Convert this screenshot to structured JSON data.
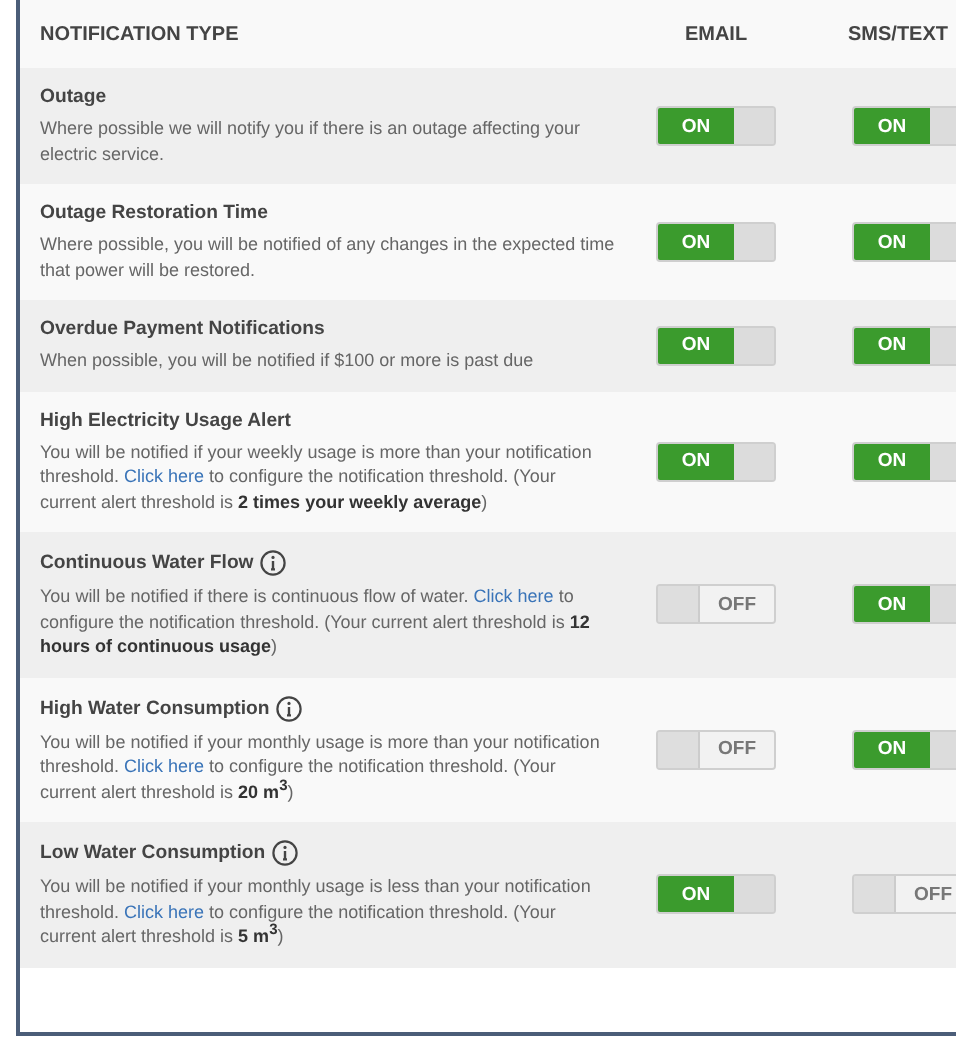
{
  "header": {
    "type": "NOTIFICATION TYPE",
    "email": "EMAIL",
    "sms": "SMS/TEXT"
  },
  "rows": [
    {
      "title": "Outage",
      "info": false,
      "description": [
        {
          "kind": "text",
          "text": "Where possible we will notify you if there is an outage affecting your electric service."
        }
      ],
      "email": {
        "on": true,
        "label": "ON"
      },
      "sms": {
        "on": true,
        "label": "ON"
      }
    },
    {
      "title": "Outage Restoration Time",
      "info": false,
      "description": [
        {
          "kind": "text",
          "text": "Where possible, you will be notified of any changes in the expected time that power will be restored."
        }
      ],
      "email": {
        "on": true,
        "label": "ON"
      },
      "sms": {
        "on": true,
        "label": "ON"
      }
    },
    {
      "title": "Overdue Payment Notifications",
      "info": false,
      "description": [
        {
          "kind": "text",
          "text": "When possible, you will be notified if $100 or more is past due"
        }
      ],
      "email": {
        "on": true,
        "label": "ON"
      },
      "sms": {
        "on": true,
        "label": "ON"
      }
    },
    {
      "title": "High Electricity Usage Alert",
      "info": false,
      "description": [
        {
          "kind": "text",
          "text": "You will be notified if your weekly usage is more than your notification threshold. "
        },
        {
          "kind": "link",
          "text": "Click here"
        },
        {
          "kind": "text",
          "text": " to configure the notification threshold. (Your current alert threshold is **2 times your weekly average**)"
        }
      ],
      "email": {
        "on": true,
        "label": "ON"
      },
      "sms": {
        "on": true,
        "label": "ON"
      }
    },
    {
      "title": "Continuous Water Flow",
      "info": true,
      "description": [
        {
          "kind": "text",
          "text": "You will be notified if there is continuous flow of water. "
        },
        {
          "kind": "link",
          "text": "Click here"
        },
        {
          "kind": "text",
          "text": " to configure the notification threshold. (Your current alert threshold is **12 hours of continuous usage**)"
        }
      ],
      "email": {
        "on": false,
        "label": "OFF"
      },
      "sms": {
        "on": true,
        "label": "ON"
      }
    },
    {
      "title": "High Water Consumption",
      "info": true,
      "description": [
        {
          "kind": "text",
          "text": "You will be notified if your monthly usage is more than your notification threshold. "
        },
        {
          "kind": "link",
          "text": "Click here"
        },
        {
          "kind": "text",
          "text": " to configure the notification threshold. (Your current alert threshold is **20 m$^{3}$**)"
        }
      ],
      "email": {
        "on": false,
        "label": "OFF"
      },
      "sms": {
        "on": true,
        "label": "ON"
      }
    },
    {
      "title": "Low Water Consumption",
      "info": true,
      "description": [
        {
          "kind": "text",
          "text": "You will be notified if your monthly usage is less than your notification threshold. "
        },
        {
          "kind": "link",
          "text": "Click here"
        },
        {
          "kind": "text",
          "text": " to configure the notification threshold. (Your current alert threshold is **5 m$^{3}$**)"
        }
      ],
      "email": {
        "on": true,
        "label": "ON"
      },
      "sms": {
        "on": false,
        "label": "OFF"
      }
    }
  ]
}
